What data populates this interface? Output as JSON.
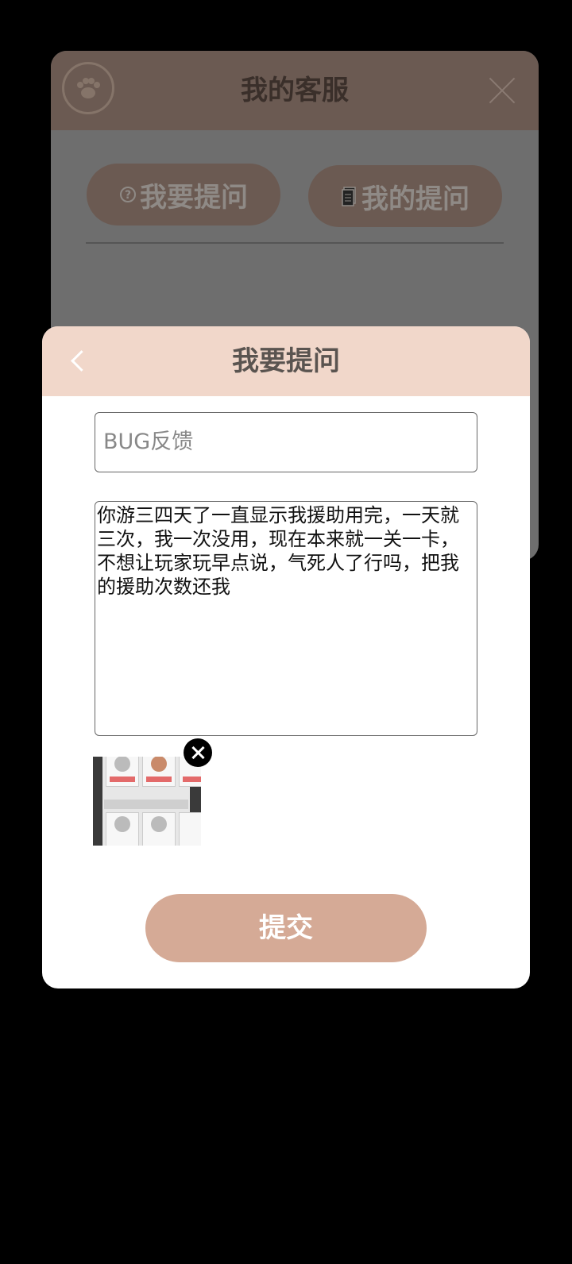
{
  "background_dialog": {
    "title": "我的客服",
    "tabs": [
      {
        "label": "我要提问",
        "icon": "question-icon"
      },
      {
        "label": "我的提问",
        "icon": "document-icon"
      }
    ]
  },
  "modal": {
    "title": "我要提问",
    "category_field": {
      "value": "BUG反馈"
    },
    "question_text": "你游三四天了一直显示我援助用完，一天就三次，我一次没用，现在本来就一关一卡，不想让玩家玩早点说，气死人了行吗，把我的援助次数还我",
    "submit_label": "提交"
  },
  "colors": {
    "modal_header": "#f1d7ca",
    "submit_button": "#d5aa96",
    "bg_header": "#6b5a52"
  }
}
